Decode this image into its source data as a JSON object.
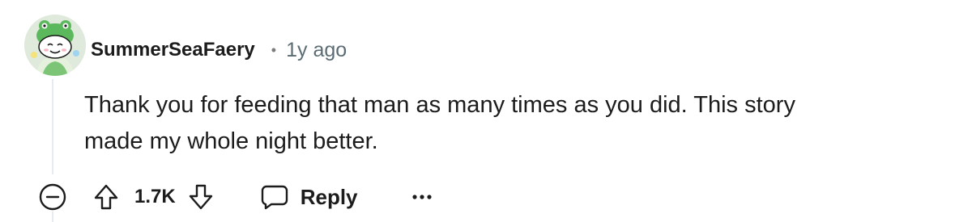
{
  "comment": {
    "author": "SummerSeaFaery",
    "separator": "•",
    "timestamp": "1y ago",
    "body_lines": [
      "Thank you for feeding that man as many times as you did. This story",
      "made my whole night better."
    ],
    "avatar_icon": "snoo-avatar-green-frog-hat"
  },
  "actions": {
    "collapse_icon": "collapse-minus-icon",
    "upvote_icon": "upvote-arrow-icon",
    "downvote_icon": "downvote-arrow-icon",
    "vote_count": "1.7K",
    "reply_icon": "comment-bubble-icon",
    "reply_label": "Reply",
    "more_icon": "more-options-icon"
  },
  "colors": {
    "text": "#1c1c1c",
    "meta": "#5c6c74",
    "thread_line": "#e5ebee",
    "avatar_bg": "#d9e8d0",
    "avatar_green": "#4caf50"
  }
}
